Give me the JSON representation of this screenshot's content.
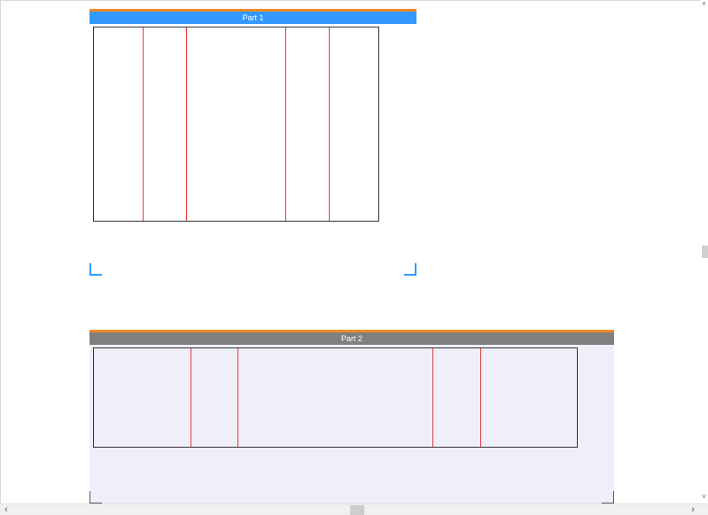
{
  "parts": [
    {
      "title": "Part 1",
      "header_color": "#3399ff",
      "accent_color": "#f08a24"
    },
    {
      "title": "Part 2",
      "header_color": "#808080",
      "accent_color": "#f08a24"
    }
  ],
  "colors": {
    "line_color": "#e23c3c",
    "selection_corner": "#3399ff",
    "part2_background": "#efeff9"
  },
  "icons": {
    "scroll_up": "scroll-up-icon",
    "scroll_down": "scroll-down-icon",
    "scroll_left": "scroll-left-icon",
    "scroll_right": "scroll-right-icon"
  },
  "scroll_glyphs": {
    "up": "˄",
    "down": "˅",
    "left": "‹",
    "right": "›"
  }
}
